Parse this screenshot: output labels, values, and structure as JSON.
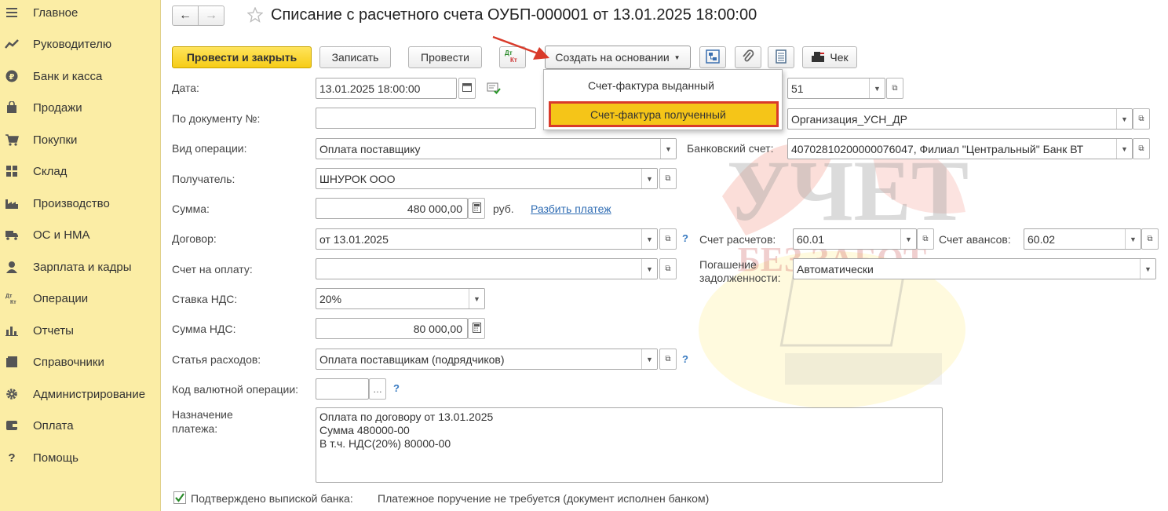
{
  "sidebar": {
    "items": [
      {
        "label": "Главное",
        "icon": "menu-icon"
      },
      {
        "label": "Руководителю",
        "icon": "trend-chart-icon"
      },
      {
        "label": "Банк и касса",
        "icon": "ruble-coin-icon"
      },
      {
        "label": "Продажи",
        "icon": "shopping-bag-icon"
      },
      {
        "label": "Покупки",
        "icon": "shopping-cart-icon"
      },
      {
        "label": "Склад",
        "icon": "warehouse-grid-icon"
      },
      {
        "label": "Производство",
        "icon": "factory-icon"
      },
      {
        "label": "ОС и НМА",
        "icon": "truck-icon"
      },
      {
        "label": "Зарплата и кадры",
        "icon": "person-icon"
      },
      {
        "label": "Операции",
        "icon": "debit-credit-icon"
      },
      {
        "label": "Отчеты",
        "icon": "bar-chart-icon"
      },
      {
        "label": "Справочники",
        "icon": "books-icon"
      },
      {
        "label": "Администрирование",
        "icon": "gear-icon"
      },
      {
        "label": "Оплата",
        "icon": "wallet-icon"
      },
      {
        "label": "Помощь",
        "icon": "question-icon"
      }
    ]
  },
  "header": {
    "title": "Списание с расчетного счета ОУБП-000001 от 13.01.2025 18:00:00",
    "back": "←",
    "forward": "→"
  },
  "toolbar": {
    "post_close": "Провести и закрыть",
    "save": "Записать",
    "post": "Провести",
    "dtkt_top": "Дт",
    "dtkt_bottom": "Кт",
    "create_based": "Создать на основании",
    "receipt": "Чек"
  },
  "menu": {
    "items": [
      "Счет-фактура выданный",
      "Счет-фактура полученный"
    ],
    "highlighted": 1
  },
  "form": {
    "date_label": "Дата:",
    "date_value": "13.01.2025 18:00:00",
    "docnum_label": "По документу №:",
    "docnum_value": "",
    "optype_label": "Вид операции:",
    "optype_value": "Оплата поставщику",
    "recipient_label": "Получатель:",
    "recipient_value": "ШНУРОК ООО",
    "amount_label": "Сумма:",
    "amount_value": "480 000,00",
    "currency": "руб.",
    "split_link": "Разбить платеж",
    "contract_label": "Договор:",
    "contract_value": "от 13.01.2025",
    "invoice_label": "Счет на оплату:",
    "invoice_value": "",
    "vat_rate_label": "Ставка НДС:",
    "vat_rate_value": "20%",
    "vat_amount_label": "Сумма НДС:",
    "vat_amount_value": "80 000,00",
    "expense_label": "Статья расходов:",
    "expense_value": "Оплата поставщикам (подрядчиков)",
    "currency_op_label": "Код валютной операции:",
    "currency_op_value": "",
    "purpose_label_1": "Назначение",
    "purpose_label_2": "платежа:",
    "purpose_lines": [
      "Оплата по договору от 13.01.2025",
      "Сумма 480000-00",
      "В т.ч. НДС(20%) 80000-00"
    ],
    "account_value": "51",
    "org_value": "Организация_УСН_ДР",
    "bank_account_label": "Банковский счет:",
    "bank_account_value": "40702810200000076047, Филиал \"Центральный\" Банк ВТ",
    "settle_account_label": "Счет расчетов:",
    "settle_account_value": "60.01",
    "advance_account_label": "Счет авансов:",
    "advance_account_value": "60.02",
    "debt_label_1": "Погашение",
    "debt_label_2": "задолженности:",
    "debt_value": "Автоматически",
    "help_mark": "?"
  },
  "footer": {
    "confirmed_label": "Подтверждено выпиской банка:",
    "confirmed_checked": true,
    "status_text": "Платежное поручение не требуется (документ исполнен банком)"
  },
  "watermark": {
    "line1": "УЧЕТ",
    "line2": "БЕЗ ЗАБОТ"
  },
  "colors": {
    "sidebar_bg": "#fbeda5",
    "primary_button": "#f6cc16",
    "menu_highlight": "#f5c518",
    "highlight_border": "#d93a2a",
    "link": "#2f6cb3"
  }
}
